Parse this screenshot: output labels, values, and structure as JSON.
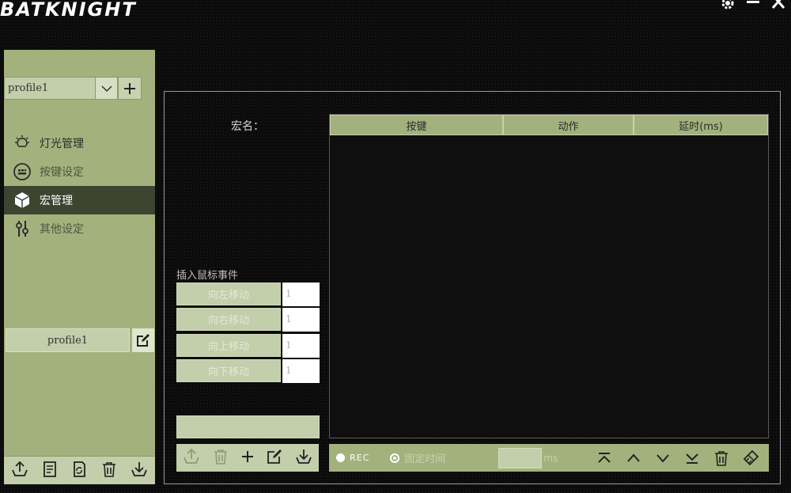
{
  "app": {
    "logo": "BATKNIGHT"
  },
  "window_controls": {
    "settings_icon": "gear-icon",
    "minimize_icon": "minimize-icon",
    "close_icon": "close-icon"
  },
  "sidebar": {
    "profile_select": {
      "value": "profile1"
    },
    "nav": [
      {
        "label": "灯光管理",
        "icon": "bulb-icon"
      },
      {
        "label": "按键设定",
        "icon": "keyboard-icon"
      },
      {
        "label": "宏管理",
        "icon": "cube-icon",
        "active": true
      },
      {
        "label": "其他设定",
        "icon": "sliders-icon"
      }
    ],
    "profile_name": "profile1"
  },
  "main": {
    "macro_name_label": "宏名：",
    "table": {
      "headers": [
        "按键",
        "动作",
        "延时(ms)"
      ],
      "rows": []
    },
    "insert_mouse_label": "插入鼠标事件",
    "move_buttons": [
      {
        "label": "向左移动",
        "value": "1"
      },
      {
        "label": "向右移动",
        "value": "1"
      },
      {
        "label": "向上移动",
        "value": "1"
      },
      {
        "label": "向下移动",
        "value": "1"
      }
    ],
    "bottom_bar": {
      "rec_label": "REC",
      "fixed_time_label": "固定时间",
      "delay_value": "",
      "unit_label": "ms"
    }
  },
  "colors": {
    "accent": "#a3b27d",
    "accent_light": "#c3ceaa",
    "active_nav": "#3d4430",
    "background": "#0b0b0b"
  }
}
